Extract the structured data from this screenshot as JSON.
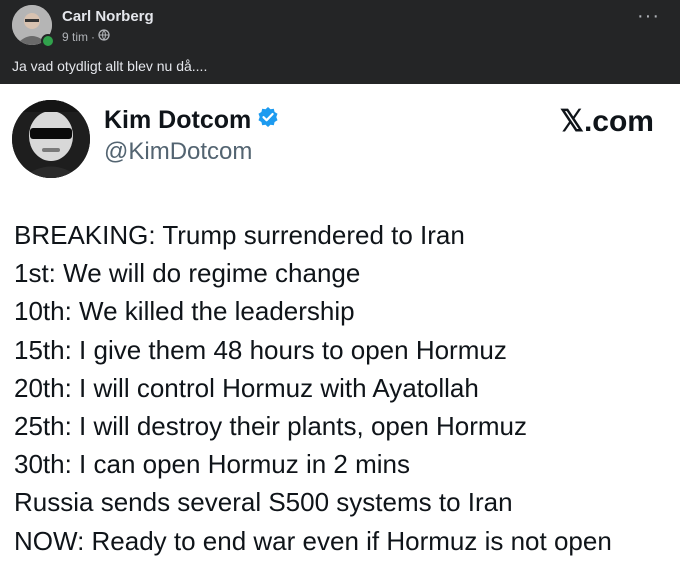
{
  "post": {
    "author": "Carl Norberg",
    "time": "9 tim",
    "time_separator": "·",
    "caption": "Ja vad otydligt allt blev nu då....",
    "more_icon": "···"
  },
  "tweet": {
    "name": "Kim Dotcom",
    "handle": "@KimDotcom",
    "logo": "𝕏.com",
    "lines": [
      "BREAKING: Trump surrendered to Iran",
      "1st: We will do regime change",
      "10th: We killed the leadership",
      "15th: I give them 48 hours to open Hormuz",
      "20th: I will control Hormuz with Ayatollah",
      "25th: I will destroy their plants, open Hormuz",
      "30th: I can open Hormuz in 2 mins",
      "Russia sends several S500 systems to Iran",
      "NOW: Ready to end war even if Hormuz is not open"
    ]
  },
  "colors": {
    "post_bg": "#242526",
    "post_text": "#e4e6eb",
    "post_meta": "#b0b3b8",
    "online": "#31a24c",
    "verified": "#1d9bf0",
    "tweet_text": "#0f1419",
    "tweet_handle": "#536471"
  }
}
